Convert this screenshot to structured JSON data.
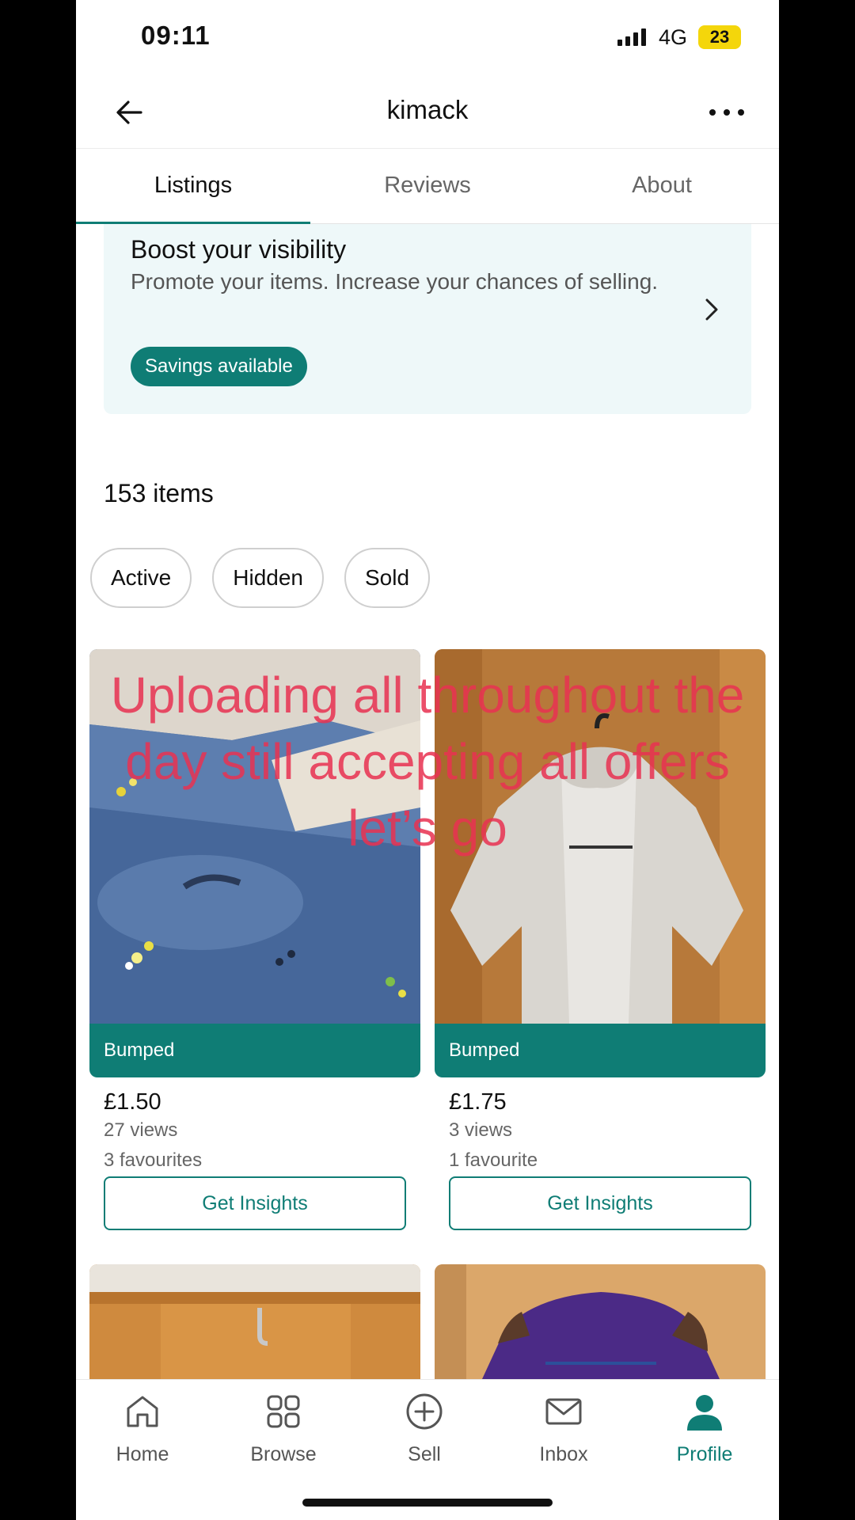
{
  "status_bar": {
    "time": "09:11",
    "network": "4G",
    "battery": "23"
  },
  "header": {
    "title": "kimack"
  },
  "tabs": [
    {
      "label": "Listings",
      "active": true
    },
    {
      "label": "Reviews",
      "active": false
    },
    {
      "label": "About",
      "active": false
    }
  ],
  "boost": {
    "title": "Boost your visibility",
    "description": "Promote your items. Increase your chances of selling.",
    "badge": "Savings available"
  },
  "items_count": "153 items",
  "filters": [
    "Active",
    "Hidden",
    "Sold"
  ],
  "items": [
    {
      "badge": "Bumped",
      "price": "£1.50",
      "views": "27 views",
      "favourites": "3 favourites",
      "action": "Get Insights"
    },
    {
      "badge": "Bumped",
      "price": "£1.75",
      "views": "3 views",
      "favourites": "1 favourite",
      "action": "Get Insights"
    }
  ],
  "overlay_caption": "Uploading all throughout the day still accepting all offers let’s go",
  "nav": [
    {
      "label": "Home",
      "icon": "home-icon",
      "active": false
    },
    {
      "label": "Browse",
      "icon": "grid-icon",
      "active": false
    },
    {
      "label": "Sell",
      "icon": "plus-circle-icon",
      "active": false
    },
    {
      "label": "Inbox",
      "icon": "envelope-icon",
      "active": false
    },
    {
      "label": "Profile",
      "icon": "person-icon",
      "active": true
    }
  ],
  "colors": {
    "accent": "#0f7d75",
    "caption": "#e83252",
    "boost_bg": "#eef8f9"
  }
}
